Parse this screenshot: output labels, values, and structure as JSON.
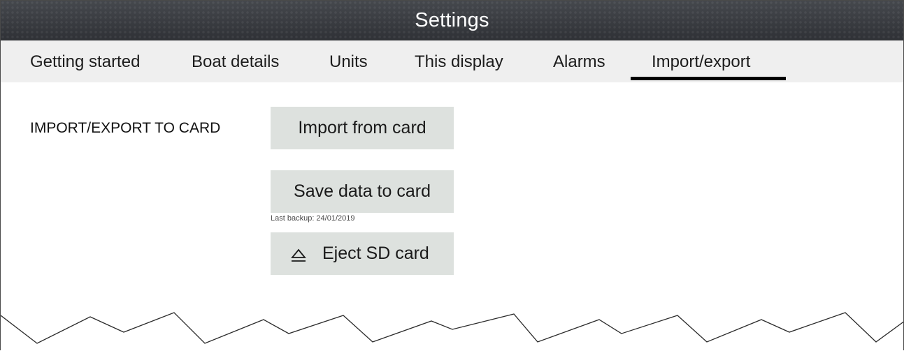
{
  "header": {
    "title": "Settings"
  },
  "tabs": [
    {
      "label": "Getting started",
      "active": false
    },
    {
      "label": "Boat details",
      "active": false
    },
    {
      "label": "Units",
      "active": false
    },
    {
      "label": "This display",
      "active": false
    },
    {
      "label": "Alarms",
      "active": false
    },
    {
      "label": "Import/export",
      "active": true
    }
  ],
  "main": {
    "section_label": "IMPORT/EXPORT TO CARD",
    "import_button": "Import from card",
    "save_button": "Save data to card",
    "last_backup": "Last backup: 24/01/2019",
    "eject_button": "Eject SD card",
    "eject_icon": "eject-icon"
  },
  "colors": {
    "titlebar": "#3a3d42",
    "tabbar": "#efefef",
    "button": "#dde1de",
    "active_tab_underline": "#000000"
  }
}
